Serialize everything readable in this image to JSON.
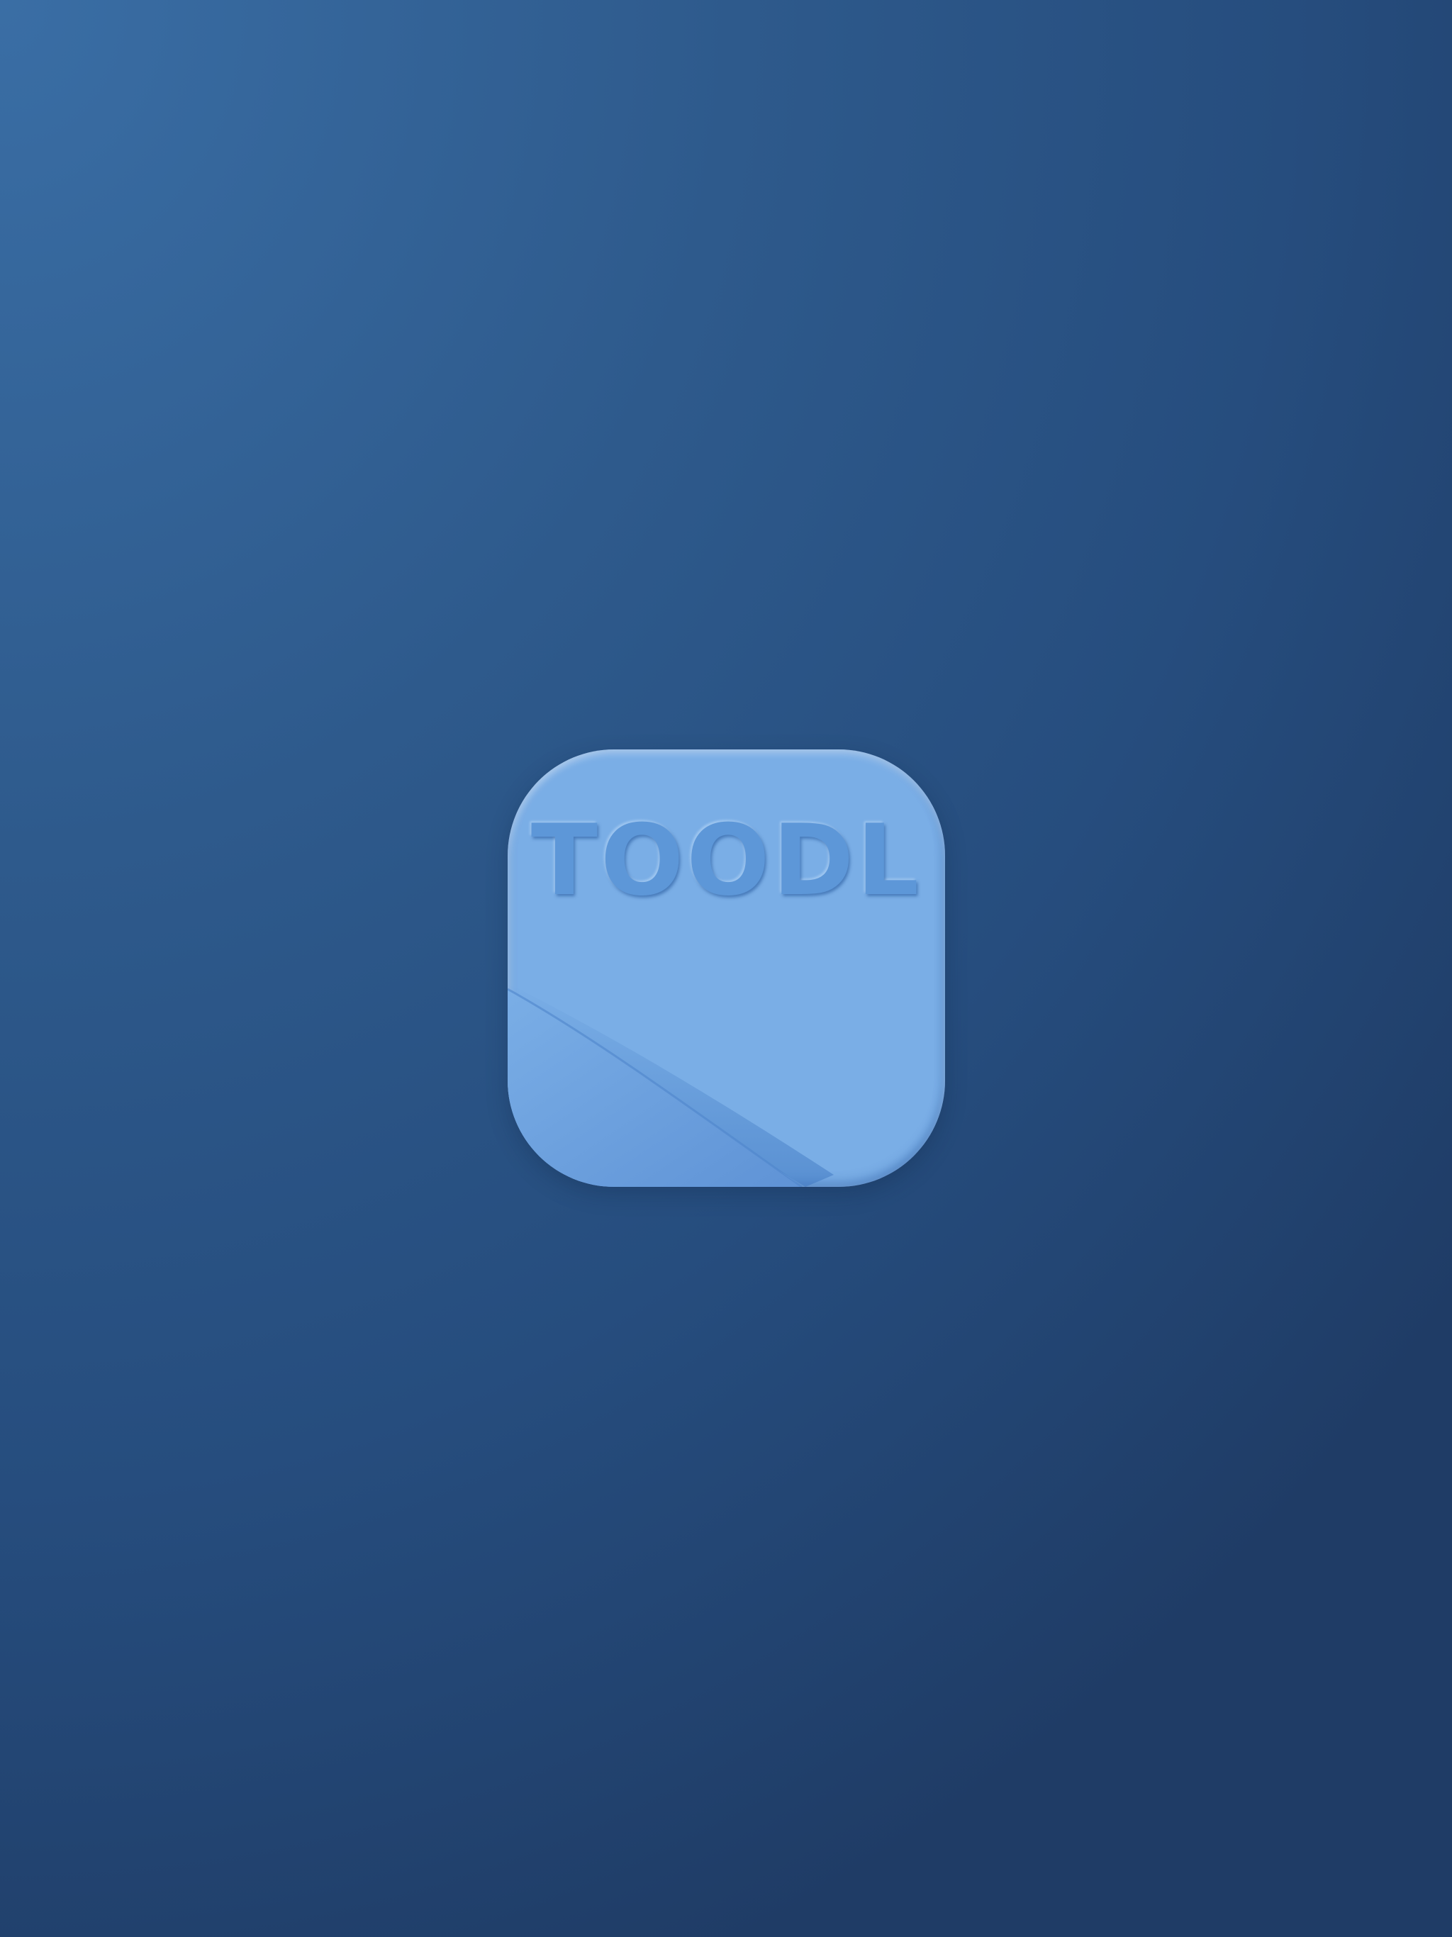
{
  "app": {
    "name": "TOODL",
    "icon_name": "toodl-app-icon"
  },
  "colors": {
    "background_top": "#3a6ea5",
    "background_bottom": "#1f3c66",
    "icon_face": "#7aaee6",
    "icon_letters": "#5d97d8"
  }
}
